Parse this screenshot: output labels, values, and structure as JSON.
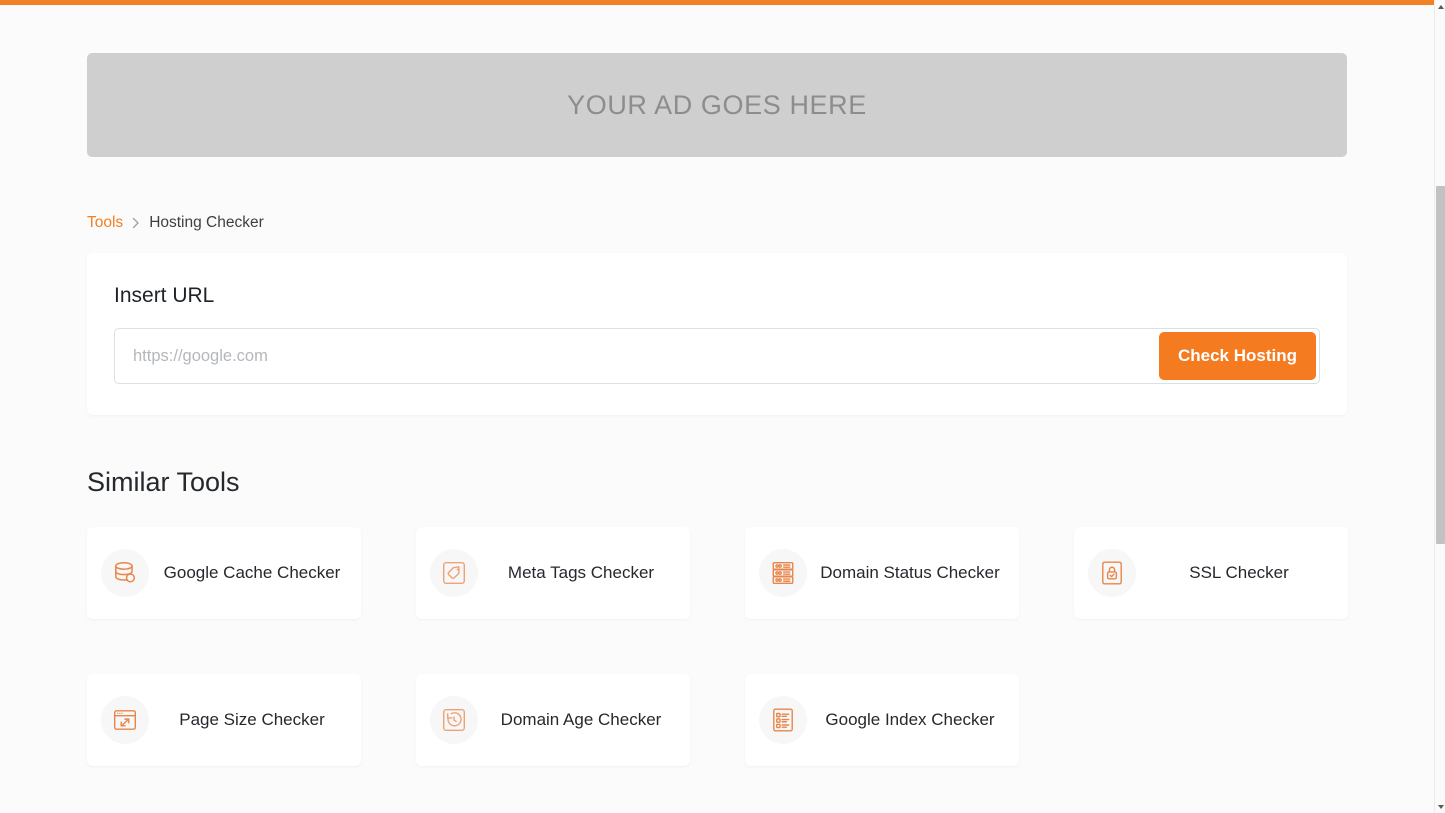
{
  "theme": {
    "accent": "#f08124",
    "button": "#f47b20",
    "ad_background": "#cfcfcf",
    "page_background": "#fbfbfc",
    "card_background": "#ffffff",
    "icon_color": "#e8864a"
  },
  "ad": {
    "text": "YOUR AD GOES HERE"
  },
  "breadcrumb": {
    "root_label": "Tools",
    "separator": "›",
    "current_label": "Hosting Checker"
  },
  "url_form": {
    "title": "Insert URL",
    "input_value": "",
    "placeholder": "https://google.com",
    "submit_label": "Check Hosting"
  },
  "similar_tools": {
    "title": "Similar Tools",
    "items": [
      {
        "label": "Google Cache Checker",
        "icon": "database-icon"
      },
      {
        "label": "Meta Tags Checker",
        "icon": "tag-icon"
      },
      {
        "label": "Domain Status Checker",
        "icon": "server-rack-icon"
      },
      {
        "label": "SSL Checker",
        "icon": "lock-document-icon"
      },
      {
        "label": "Page Size Checker",
        "icon": "window-resize-icon"
      },
      {
        "label": "Domain Age Checker",
        "icon": "clock-history-icon"
      },
      {
        "label": "Google Index Checker",
        "icon": "checklist-icon"
      }
    ]
  }
}
